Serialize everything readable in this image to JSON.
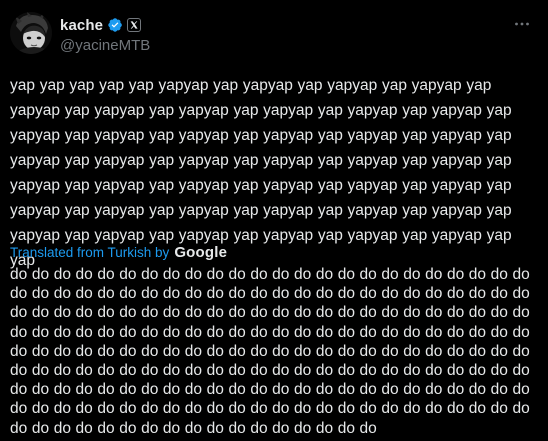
{
  "user": {
    "display_name": "kache",
    "handle": "@yacineMTB",
    "avatar_icon": "avatar-image",
    "verified_icon": "verified-badge-icon",
    "affiliate_icon": "x-logo-icon"
  },
  "more_icon": "more-horizontal-icon",
  "tweet": {
    "text": "yap yap yap yap yap yapyap yap yapyap yap yapyap yap yapyap yap yapyap yap yapyap yap yapyap yap yapyap yap yapyap yap yapyap yap yapyap yap yapyap yap yapyap yap yapyap yap yapyap yap yapyap yap yapyap yap yapyap yap yapyap yap yapyap yap yapyap yap yapyap yap yapyap yap yapyap yap yapyap yap yapyap yap yapyap yap yapyap yap yapyap yap yapyap yap yapyap yap yapyap yap yapyap yap yapyap yap yapyap yap yapyap yap yapyap yap yapyap yap yapyap yap yapyap yap yap"
  },
  "translation": {
    "label": "Translated from Turkish by",
    "provider": "Google",
    "text": "do do do do do do do do do do do do do do do do do do do do do do do do do do do do do do do do do do do do do do do do do do do do do do do do do do do do do do do do do do do do do do do do do do do do do do do do do do do do do do do do do do do do do do do do do do do do do do do do do do do do do do do do do do do do do do do do do do do do do do do do do do do do do do do do do do do do do do do do do do do do do do do do do do do do do do do do do do do do do do do do do do do do do do do do do do do do do do do do do do do do do do do do do do do do do do do do do do do do do do do do do do do do do do do do do"
  },
  "colors": {
    "background": "#000000",
    "text": "#e7e9ea",
    "muted": "#71767b",
    "link": "#1d9bf0",
    "verified": "#1d9bf0"
  }
}
